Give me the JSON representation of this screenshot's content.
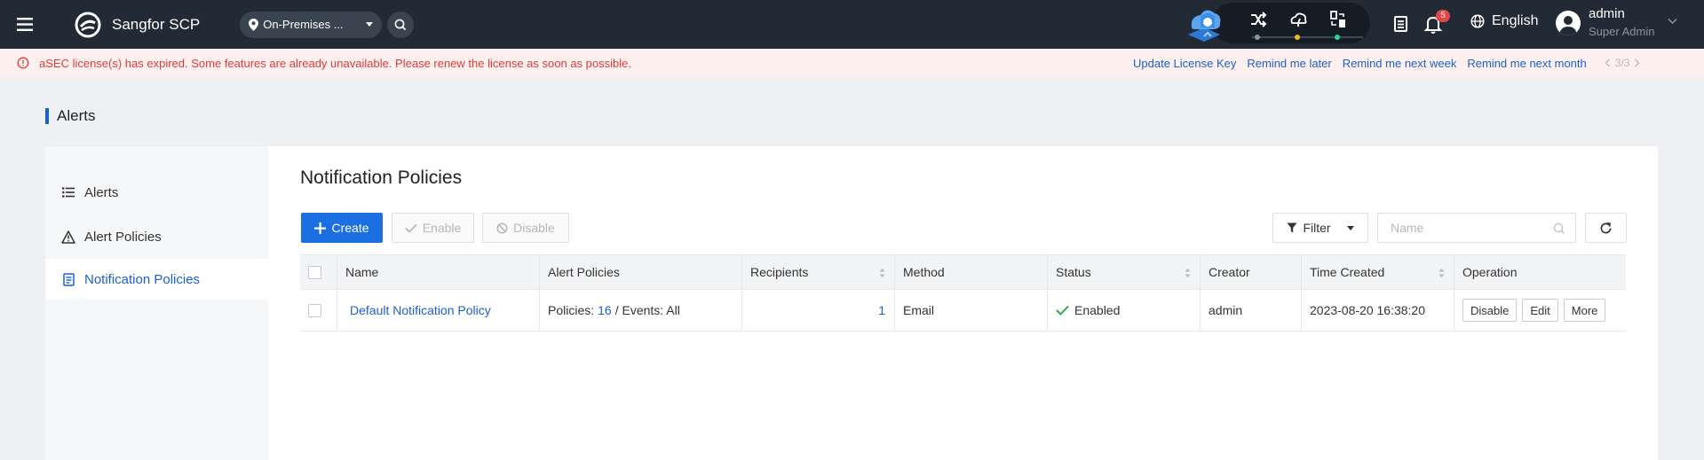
{
  "app": {
    "title": "Sangfor SCP"
  },
  "location": {
    "label": "On-Premises ..."
  },
  "notifications": {
    "count": "5"
  },
  "language": {
    "label": "English"
  },
  "user": {
    "name": "admin",
    "role": "Super Admin"
  },
  "banner": {
    "message": "aSEC license(s) has expired. Some features are already unavailable. Please renew the license as soon as possible.",
    "links": [
      "Update License Key",
      "Remind me later",
      "Remind me next week",
      "Remind me next month"
    ],
    "pager": "3/3"
  },
  "page": {
    "title": "Alerts"
  },
  "sidebar": {
    "items": [
      {
        "label": "Alerts",
        "icon": "list-icon"
      },
      {
        "label": "Alert Policies",
        "icon": "warning-triangle-icon"
      },
      {
        "label": "Notification Policies",
        "icon": "document-icon",
        "active": true
      }
    ]
  },
  "main": {
    "title": "Notification Policies",
    "toolbar": {
      "create_label": "Create",
      "enable_label": "Enable",
      "disable_label": "Disable",
      "filter_label": "Filter",
      "name_placeholder": "Name"
    },
    "table": {
      "columns": [
        "Name",
        "Alert Policies",
        "Recipients",
        "Method",
        "Status",
        "Creator",
        "Time Created",
        "Operation"
      ],
      "rows": [
        {
          "name": "Default Notification Policy",
          "policies_prefix": "Policies:",
          "policies_count": "16",
          "events_text": "/ Events: All",
          "recipients": "1",
          "method": "Email",
          "status": "Enabled",
          "creator": "admin",
          "time_created": "2023-08-20 16:38:20",
          "operations": [
            "Disable",
            "Edit",
            "More"
          ]
        }
      ]
    }
  },
  "colors": {
    "accent": "#1c6fe0",
    "link": "#1c5fd1",
    "danger": "#e03b3b",
    "topbar": "#222a35",
    "success": "#2fa84f"
  }
}
